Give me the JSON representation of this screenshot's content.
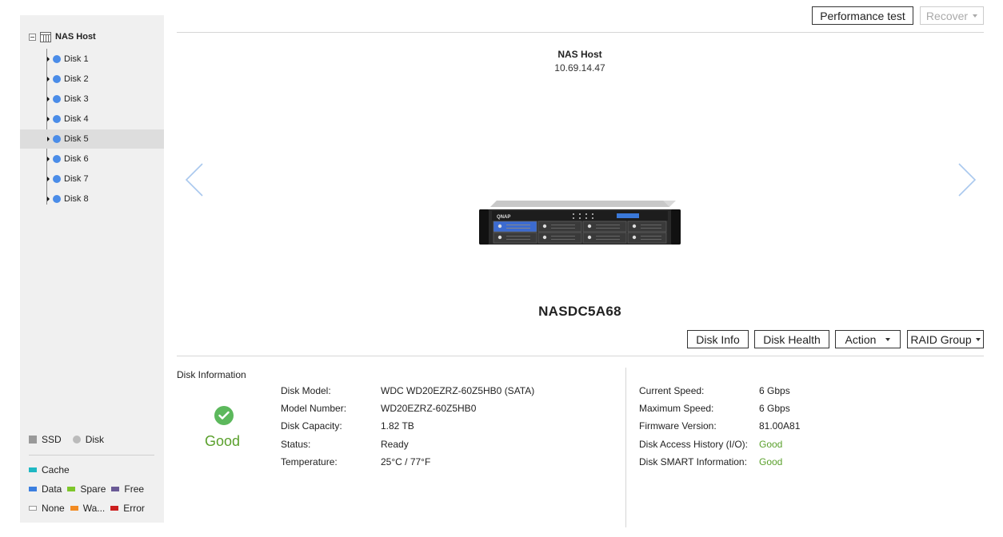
{
  "sidebar": {
    "root_label": "NAS Host",
    "disks": [
      {
        "label": "Disk 1",
        "selected": false
      },
      {
        "label": "Disk 2",
        "selected": false
      },
      {
        "label": "Disk 3",
        "selected": false
      },
      {
        "label": "Disk 4",
        "selected": false
      },
      {
        "label": "Disk 5",
        "selected": true
      },
      {
        "label": "Disk 6",
        "selected": false
      },
      {
        "label": "Disk 7",
        "selected": false
      },
      {
        "label": "Disk 8",
        "selected": false
      }
    ],
    "disk_color": "#4a8ce8",
    "legend": {
      "ssd": "SSD",
      "disk": "Disk",
      "cache": {
        "label": "Cache",
        "color": "#1fb8c3"
      },
      "data": {
        "label": "Data",
        "color": "#3c7fe0"
      },
      "spare": {
        "label": "Spare",
        "color": "#7ec62b"
      },
      "free": {
        "label": "Free",
        "color": "#6a5a96"
      },
      "none": {
        "label": "None",
        "color": "#ffffff"
      },
      "warning": {
        "label": "Wa...",
        "color": "#f28b22"
      },
      "error": {
        "label": "Error",
        "color": "#cc1f1f"
      }
    }
  },
  "toolbar": {
    "performance_test": "Performance test",
    "recover": "Recover"
  },
  "host": {
    "name": "NAS Host",
    "ip": "10.69.14.47",
    "device_name": "NASDC5A68"
  },
  "actions": {
    "disk_info": "Disk Info",
    "disk_health": "Disk Health",
    "action": "Action",
    "raid_group": "RAID Group"
  },
  "disk_information": {
    "title": "Disk Information",
    "health": "Good",
    "left": [
      {
        "label": "Disk Model:",
        "value": "WDC WD20EZRZ-60Z5HB0 (SATA)"
      },
      {
        "label": "Model Number:",
        "value": "WD20EZRZ-60Z5HB0"
      },
      {
        "label": "Disk Capacity:",
        "value": "1.82 TB"
      },
      {
        "label": "Status:",
        "value": "Ready"
      },
      {
        "label": "Temperature:",
        "value": "25°C / 77°F"
      }
    ],
    "right": [
      {
        "label": "Current Speed:",
        "value": "6 Gbps"
      },
      {
        "label": "Maximum Speed:",
        "value": "6 Gbps"
      },
      {
        "label": "Firmware Version:",
        "value": "81.00A81"
      },
      {
        "label": "Disk Access History (I/O):",
        "value": "Good",
        "good": true
      },
      {
        "label": "Disk SMART Information:",
        "value": "Good",
        "good": true
      }
    ]
  },
  "colors": {
    "good": "#5aa02c",
    "accent": "#4a8ce8"
  }
}
